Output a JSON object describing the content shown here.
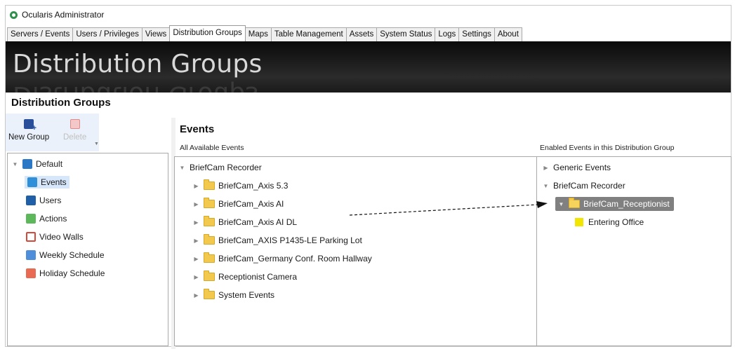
{
  "window": {
    "title": "Ocularis Administrator"
  },
  "tabs": [
    {
      "label": "Servers / Events",
      "active": false
    },
    {
      "label": "Users / Privileges",
      "active": false
    },
    {
      "label": "Views",
      "active": false
    },
    {
      "label": "Distribution Groups",
      "active": true
    },
    {
      "label": "Maps",
      "active": false
    },
    {
      "label": "Table Management",
      "active": false
    },
    {
      "label": "Assets",
      "active": false
    },
    {
      "label": "System Status",
      "active": false
    },
    {
      "label": "Logs",
      "active": false
    },
    {
      "label": "Settings",
      "active": false
    },
    {
      "label": "About",
      "active": false
    }
  ],
  "banner": {
    "title": "Distribution Groups"
  },
  "page": {
    "section_title": "Distribution Groups"
  },
  "toolbar": {
    "new_group_label": "New Group",
    "delete_label": "Delete",
    "new_group_icon": "new-group-icon",
    "delete_icon": "delete-icon"
  },
  "left_tree": {
    "root": {
      "label": "Default",
      "icon": "default-group-icon"
    },
    "children": [
      {
        "label": "Events",
        "icon": "events-icon",
        "selected": true
      },
      {
        "label": "Users",
        "icon": "users-icon"
      },
      {
        "label": "Actions",
        "icon": "actions-icon"
      },
      {
        "label": "Video Walls",
        "icon": "video-walls-icon"
      },
      {
        "label": "Weekly Schedule",
        "icon": "weekly-schedule-icon"
      },
      {
        "label": "Holiday Schedule",
        "icon": "holiday-schedule-icon"
      }
    ]
  },
  "events_panel": {
    "title": "Events",
    "all_label": "All Available Events",
    "enabled_label": "Enabled Events in this Distribution Group"
  },
  "available_tree": {
    "root": "BriefCam Recorder",
    "items": [
      "BriefCam_Axis 5.3",
      "BriefCam_Axis AI",
      "BriefCam_Axis AI DL",
      "BriefCam_AXIS P1435-LE Parking Lot",
      "BriefCam_Germany Conf. Room Hallway",
      "Receptionist Camera",
      "System Events"
    ]
  },
  "enabled_tree": {
    "generic": "Generic Events",
    "recorder": "BriefCam Recorder",
    "selected_folder": "BriefCam_Receptionist",
    "event": "Entering Office"
  },
  "colors": {
    "selection_gray": "#808080",
    "event_yellow": "#f2e600",
    "folder_yellow": "#f2c94c",
    "toolbar_blue": "#eaf1fa"
  }
}
